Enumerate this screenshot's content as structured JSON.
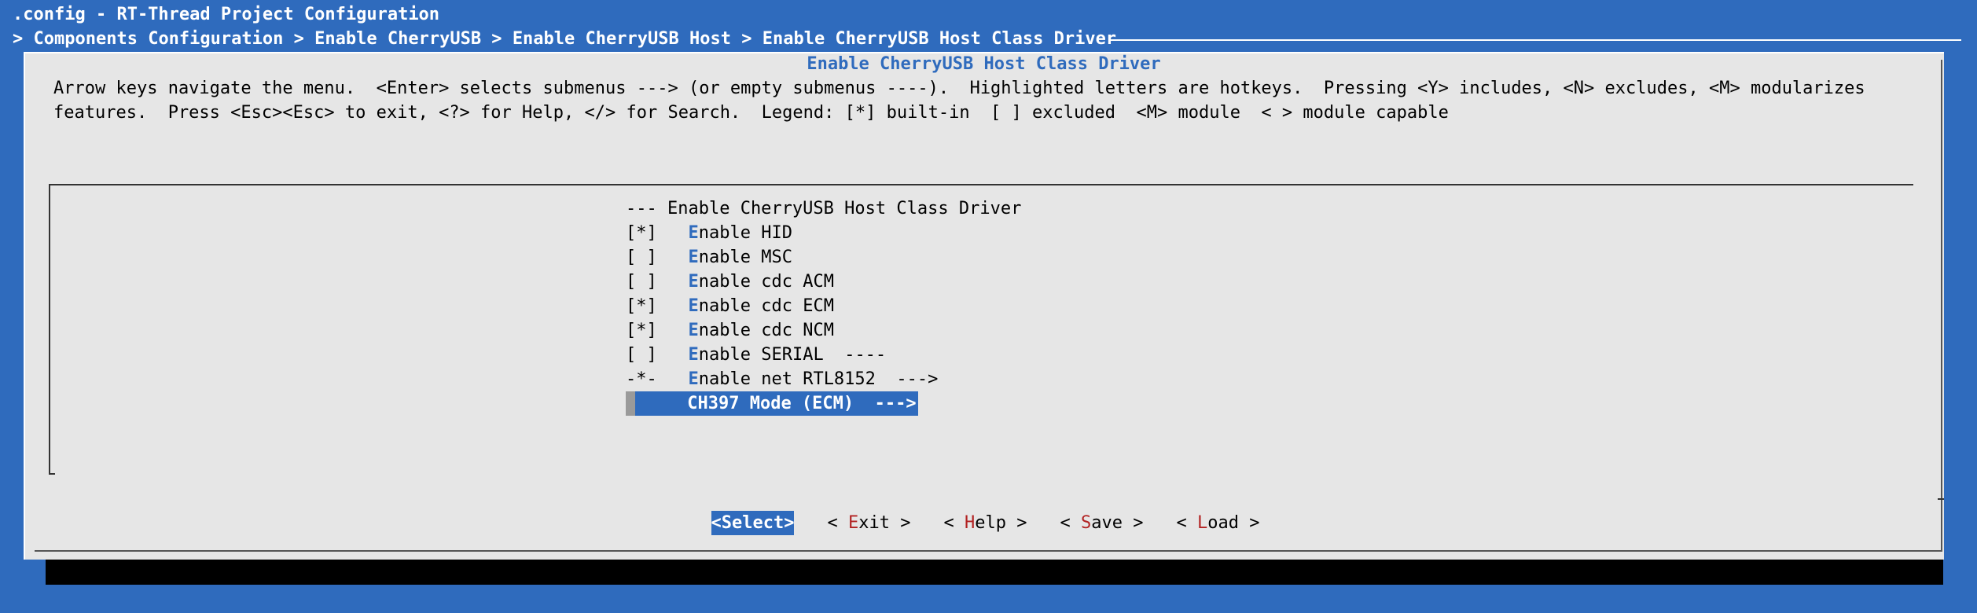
{
  "window": {
    "title": ".config - RT-Thread Project Configuration"
  },
  "breadcrumb": {
    "prefix": "> ",
    "items": [
      "Components Configuration",
      "Enable CherryUSB",
      "Enable CherryUSB Host",
      "Enable CherryUSB Host Class Driver"
    ],
    "separator": " > "
  },
  "dialog": {
    "title": "Enable CherryUSB Host Class Driver",
    "help_text": "Arrow keys navigate the menu.  <Enter> selects submenus ---> (or empty submenus ----).  Highlighted letters are hotkeys.  Pressing <Y> includes, <N> excludes, <M> modularizes features.  Press <Esc><Esc> to exit, <?> for Help, </> for Search.  Legend: [*] built-in  [ ] excluded  <M> module  < > module capable"
  },
  "menu": {
    "header": "--- Enable CherryUSB Host Class Driver",
    "items": [
      {
        "marker": "[*]",
        "hotkey": "E",
        "rest": "nable HID",
        "suffix": ""
      },
      {
        "marker": "[ ]",
        "hotkey": "E",
        "rest": "nable MSC",
        "suffix": ""
      },
      {
        "marker": "[ ]",
        "hotkey": "E",
        "rest": "nable cdc ACM",
        "suffix": ""
      },
      {
        "marker": "[*]",
        "hotkey": "E",
        "rest": "nable cdc ECM",
        "suffix": ""
      },
      {
        "marker": "[*]",
        "hotkey": "E",
        "rest": "nable cdc NCM",
        "suffix": ""
      },
      {
        "marker": "[ ]",
        "hotkey": "E",
        "rest": "nable SERIAL",
        "suffix": "  ----"
      },
      {
        "marker": "-*-",
        "hotkey": "E",
        "rest": "nable net RTL8152",
        "suffix": "  --->"
      }
    ],
    "selected": {
      "label": "CH397 Mode (ECM)",
      "suffix": "  --->"
    }
  },
  "buttons": {
    "select": {
      "open": "<",
      "hotkey": "Select",
      "rest": "",
      "close": ">"
    },
    "exit": {
      "open": "< ",
      "hotkey": "E",
      "rest": "xit",
      "close": " >"
    },
    "help": {
      "open": "< ",
      "hotkey": "H",
      "rest": "elp",
      "close": " >"
    },
    "save": {
      "open": "< ",
      "hotkey": "S",
      "rest": "ave",
      "close": " >"
    },
    "load": {
      "open": "< ",
      "hotkey": "L",
      "rest": "oad",
      "close": " >"
    }
  },
  "colors": {
    "background": "#2f6bbd",
    "dialog": "#e6e6e6",
    "hotkey": "#2f6bbd",
    "button_hotkey": "#b22222"
  }
}
